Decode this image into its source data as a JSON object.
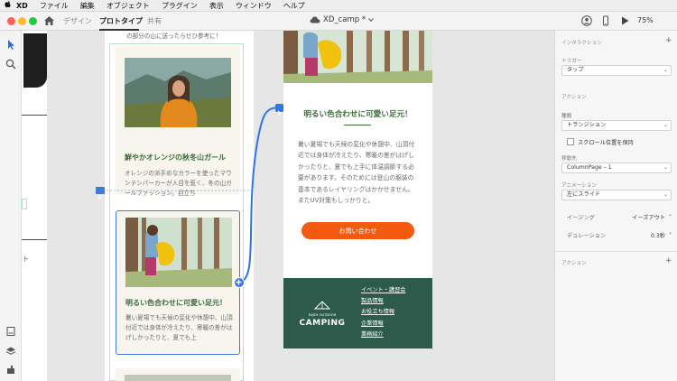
{
  "menubar": {
    "apple": "",
    "items": [
      "XD",
      "ファイル",
      "編集",
      "オブジェクト",
      "プラグイン",
      "表示",
      "ウィンドウ",
      "ヘルプ"
    ]
  },
  "titlebar": {
    "tabs": [
      "デザイン",
      "プロトタイプ",
      "共有"
    ],
    "active_tab": "プロトタイプ",
    "doc_title": "XD_camp *",
    "zoom": "75%"
  },
  "canvas": {
    "top_text": "の部分の山に送ったらせひ参考に！",
    "card1": {
      "title": "鮮やかオレンジの秋冬山ガール",
      "text": "オレンジの派手めなカラーを使ったマウンテンパーカーが人目を惹く、冬の山ガールファッション。目立ち"
    },
    "card2": {
      "title": "明るい色合わせに可愛い足元！",
      "text": "暑い夏場でも天候の変化や休憩中、山頂付近では身体が冷えたり、寒暖の差がはげしかったりと、夏でも上"
    },
    "right": {
      "title": "明るい色合わせに可愛い足元！",
      "text": "暑い夏場でも天候の変化や休憩中、山頂付近では身体が冷えたり、寒暖の差がはげしかったりと、夏でも上手に体温調節する必要があります。そのためには登山の服装の基本であるレイヤリングはかかせません。またUV対策もしっかりと。",
      "button": "お問い合わせ",
      "footer": {
        "logo_small": "ENJOY OUTDOOR",
        "logo": "CAMPING",
        "links": [
          "イベント・講習会",
          "製品情報",
          "お役立ち情報",
          "企業情報",
          "業務紹介"
        ]
      }
    }
  },
  "panel": {
    "interaction_head": "インタラクション",
    "trigger_label": "トリガー",
    "trigger_value": "タップ",
    "action_head": "アクション",
    "type_label": "種類",
    "type_value": "トランジション",
    "scroll_label": "スクロール位置を保持",
    "dest_label": "移動先",
    "dest_value": "ColumnPage – 1",
    "anim_label": "アニメーション",
    "anim_value": "左にスライド",
    "easing_label": "イージング",
    "easing_value": "イーズアウト",
    "duration_label": "デュレーション",
    "duration_value": "0.3秒",
    "action_head2": "アクション"
  }
}
